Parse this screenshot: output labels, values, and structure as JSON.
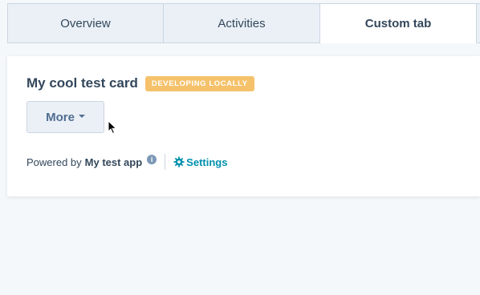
{
  "tabs": [
    {
      "label": "Overview"
    },
    {
      "label": "Activities"
    },
    {
      "label": "Custom tab"
    }
  ],
  "card": {
    "title": "My cool test card",
    "badge": "DEVELOPING LOCALLY",
    "more_label": "More"
  },
  "footer": {
    "powered_label": "Powered by",
    "app_name": "My test app",
    "info_glyph": "i",
    "settings_label": "Settings"
  },
  "colors": {
    "badge_bg": "#f5c26b",
    "link": "#0091ae",
    "text": "#33475b"
  },
  "icons": [
    "info-icon",
    "gear-icon",
    "caret-down-icon",
    "mouse-pointer-icon"
  ]
}
